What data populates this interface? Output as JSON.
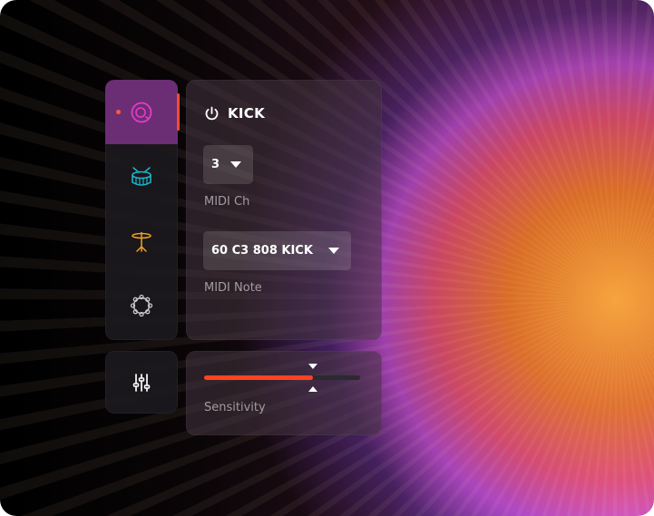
{
  "sidebar": {
    "items": [
      {
        "icon": "kick-drum-icon",
        "active": true,
        "color": "#e63bc8"
      },
      {
        "icon": "snare-drum-icon",
        "active": false,
        "color": "#1ab6c9"
      },
      {
        "icon": "cymbal-icon",
        "active": false,
        "color": "#f0a020"
      },
      {
        "icon": "tambourine-icon",
        "active": false,
        "color": "#c8c8d0"
      }
    ],
    "mixer_icon": "mixer-sliders-icon"
  },
  "instrument": {
    "power_icon": "power-icon",
    "name": "KICK",
    "midi_channel": {
      "value": "3",
      "label": "MIDI Ch"
    },
    "midi_note": {
      "value": "60 C3 808 KICK",
      "label": "MIDI Note"
    }
  },
  "sensitivity": {
    "label": "Sensitivity",
    "level": 0.7,
    "accent": "#ff4220"
  }
}
